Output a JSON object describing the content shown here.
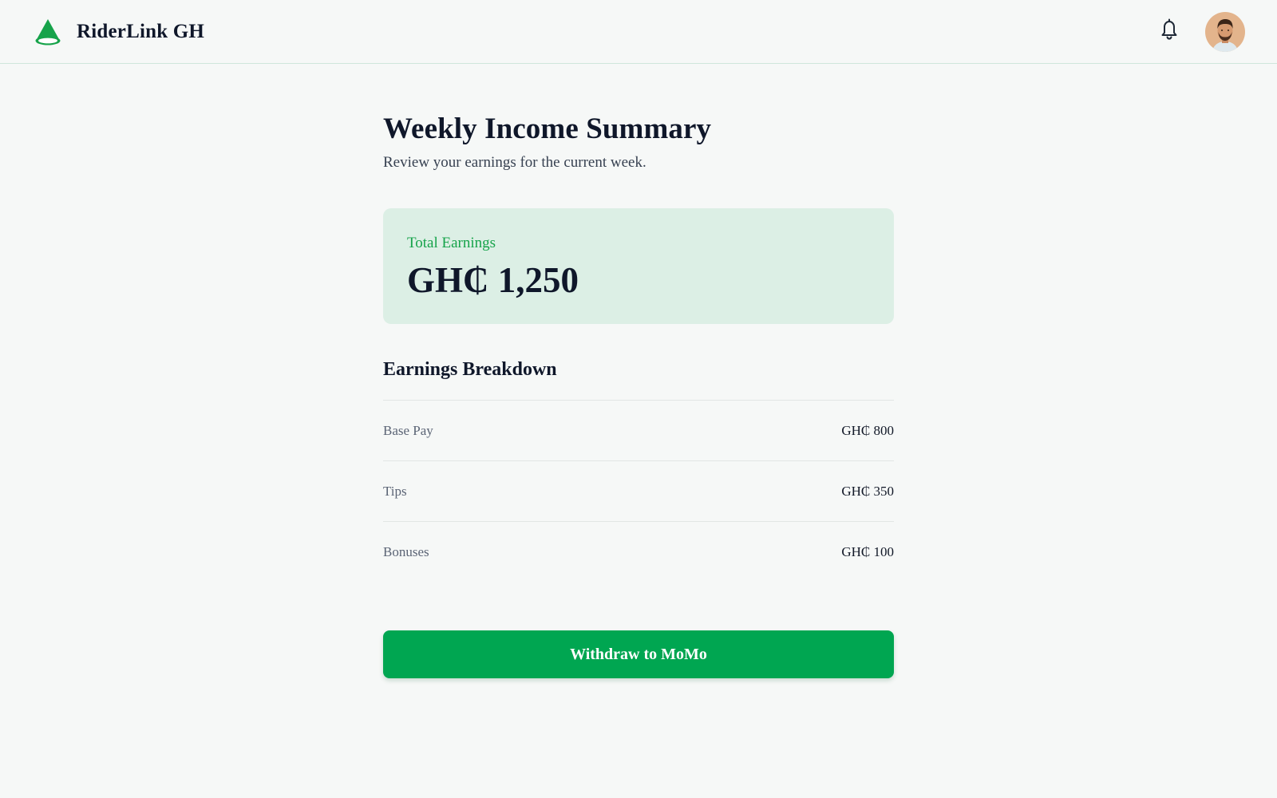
{
  "app": {
    "name": "RiderLink GH",
    "logo_icon": "cone-logo-icon",
    "brand_color": "#00a651"
  },
  "header": {
    "notification_icon": "bell-icon",
    "avatar_icon": "user-avatar"
  },
  "page": {
    "title": "Weekly Income Summary",
    "subtitle": "Review your earnings for the current week."
  },
  "total": {
    "label": "Total Earnings",
    "value": "GH₵ 1,250"
  },
  "breakdown": {
    "title": "Earnings Breakdown",
    "items": [
      {
        "label": "Base Pay",
        "value": "GH₵ 800"
      },
      {
        "label": "Tips",
        "value": "GH₵ 350"
      },
      {
        "label": "Bonuses",
        "value": "GH₵ 100"
      }
    ]
  },
  "actions": {
    "withdraw_label": "Withdraw to MoMo"
  }
}
